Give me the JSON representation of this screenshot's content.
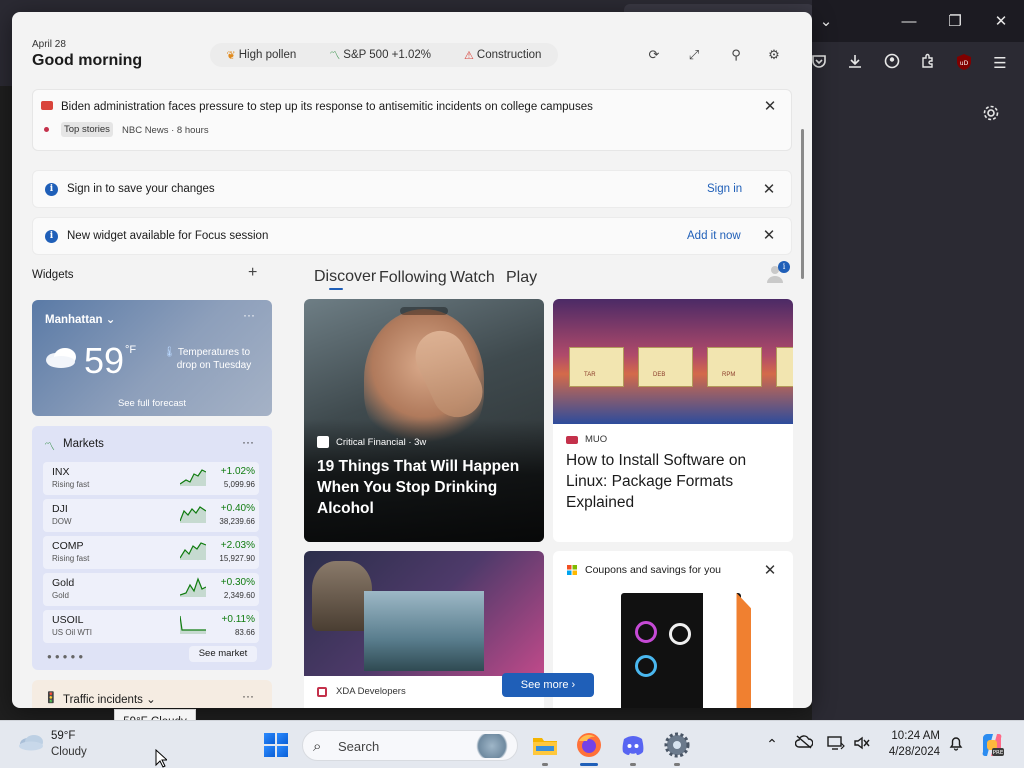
{
  "panel": {
    "date": "April 28",
    "greeting": "Good morning",
    "chips": [
      {
        "icon": "pollen-icon",
        "label": "High pollen",
        "color": "#e08a1e"
      },
      {
        "icon": "stock-icon",
        "label": "S&P 500 +1.02%",
        "color": "#2b8a3e"
      },
      {
        "icon": "construction-icon",
        "label": "Construction",
        "color": "#d9443b"
      }
    ]
  },
  "news": {
    "headline": "Biden administration faces pressure to step up its response to antisemitic incidents on college campuses",
    "tag": "Top stories",
    "meta": "NBC News · 8 hours"
  },
  "info_bars": [
    {
      "text": "Sign in to save your changes",
      "link": "Sign in"
    },
    {
      "text": "New widget available for Focus session",
      "link": "Add it now"
    }
  ],
  "widgets_label": "Widgets",
  "weather": {
    "city": "Manhattan",
    "temp": "59",
    "unit": "°F",
    "note": "Temperatures to drop on Tuesday",
    "forecast_link": "See full forecast"
  },
  "markets": {
    "title": "Markets",
    "rows": [
      {
        "symbol": "INX",
        "sub": "Rising fast",
        "change": "+1.02%",
        "price": "5,099.96"
      },
      {
        "symbol": "DJI",
        "sub": "DOW",
        "change": "+0.40%",
        "price": "38,239.66"
      },
      {
        "symbol": "COMP",
        "sub": "Rising fast",
        "change": "+2.03%",
        "price": "15,927.90"
      },
      {
        "symbol": "Gold",
        "sub": "Gold",
        "change": "+0.30%",
        "price": "2,349.60"
      },
      {
        "symbol": "USOIL",
        "sub": "US Oil WTI",
        "change": "+0.11%",
        "price": "83.66"
      }
    ],
    "see_market": "See market"
  },
  "traffic": {
    "title": "Traffic incidents"
  },
  "feed": {
    "tabs": [
      "Discover",
      "Following",
      "Watch",
      "Play"
    ],
    "hero": {
      "source": "Critical Financial · 3w",
      "title": "19 Things That Will Happen When You Stop Drinking Alcohol"
    },
    "muo": {
      "source": "MUO",
      "title": "How to Install Software on Linux: Package Formats Explained",
      "boxes": [
        "TAR",
        "DEB",
        "RPM"
      ]
    },
    "xda": {
      "source": "XDA Developers"
    },
    "coupons": {
      "title": "Coupons and savings for you"
    },
    "see_more": "See more"
  },
  "tooltip": "59°F Cloudy",
  "taskbar": {
    "temp": "59°F",
    "condition": "Cloudy",
    "search_placeholder": "Search",
    "time": "10:24 AM",
    "date": "4/28/2024"
  },
  "colors": {
    "accent": "#1f5fb8",
    "positive": "#107c10"
  }
}
